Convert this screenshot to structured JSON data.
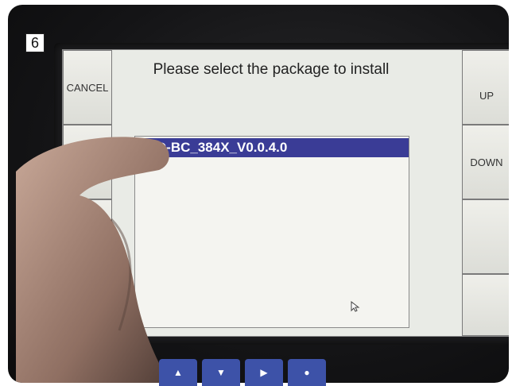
{
  "step_label": "6",
  "screen": {
    "title": "Please select the package to install",
    "left_keys": [
      "CANCEL",
      "",
      "",
      ""
    ],
    "right_keys": [
      "UP",
      "DOWN",
      "",
      ""
    ],
    "packages": [
      {
        "label": "51D-BC_384X_V0.0.4.0",
        "selected": true
      }
    ]
  },
  "keypad": {
    "keys": [
      {
        "icon": "arrow-up-icon",
        "glyph": "▲"
      },
      {
        "icon": "arrow-down-icon",
        "glyph": "▼"
      },
      {
        "icon": "arrow-right-icon",
        "glyph": "▶"
      },
      {
        "icon": "enter-dot-icon",
        "glyph": "●"
      }
    ]
  },
  "colors": {
    "selection": "#3a3c96",
    "keypad": "#3d52a8",
    "screen": "#e9ebe6"
  }
}
